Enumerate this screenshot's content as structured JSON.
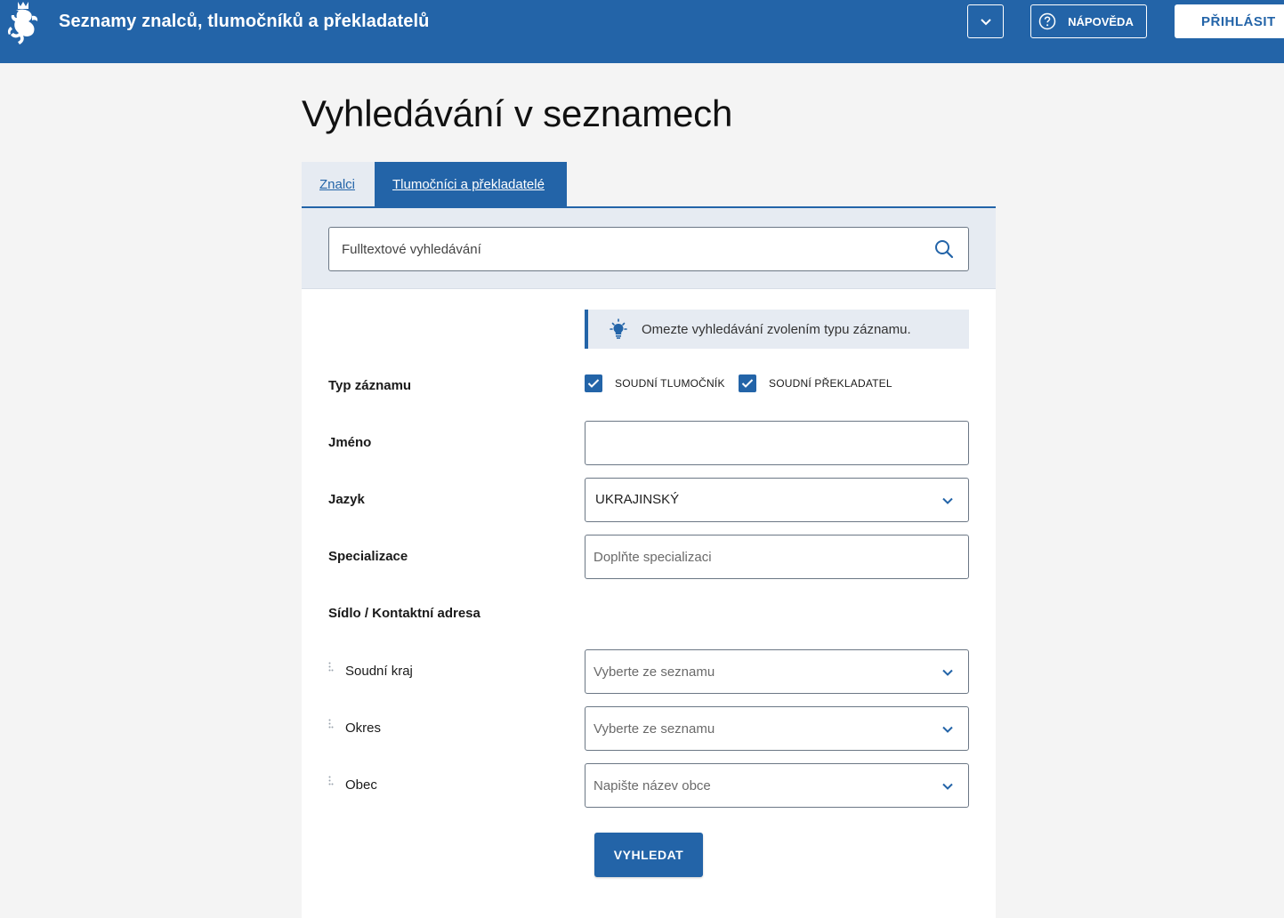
{
  "header": {
    "app_title": "Seznamy znalců, tlumočníků a překladatelů",
    "help_label": "NÁPOVĚDA",
    "login_label": "PŘIHLÁSIT"
  },
  "page": {
    "title": "Vyhledávání v seznamech"
  },
  "tabs": [
    {
      "label": "Znalci",
      "active": false
    },
    {
      "label": "Tlumočníci a překladatelé",
      "active": true
    }
  ],
  "search": {
    "placeholder": "Fulltextové vyhledávání"
  },
  "hint": {
    "text": "Omezte vyhledávání zvolením typu záznamu."
  },
  "form": {
    "record_type": {
      "label": "Typ záznamu",
      "options": [
        {
          "label": "SOUDNÍ TLUMOČNÍK",
          "checked": true
        },
        {
          "label": "SOUDNÍ PŘEKLADATEL",
          "checked": true
        }
      ]
    },
    "name": {
      "label": "Jméno",
      "value": ""
    },
    "language": {
      "label": "Jazyk",
      "value": "UKRAJINSKÝ"
    },
    "specialization": {
      "label": "Specializace",
      "placeholder": "Doplňte specializaci"
    },
    "address": {
      "label": "Sídlo / Kontaktní adresa",
      "region": {
        "label": "Soudní kraj",
        "placeholder": "Vyberte ze seznamu"
      },
      "district": {
        "label": "Okres",
        "placeholder": "Vyberte ze seznamu"
      },
      "municipality": {
        "label": "Obec",
        "placeholder": "Napište název obce"
      }
    },
    "submit_label": "VYHLEDAT"
  },
  "colors": {
    "brand": "#2364a8",
    "band": "#e6ebf2",
    "page_bg": "#f4f4f4"
  }
}
